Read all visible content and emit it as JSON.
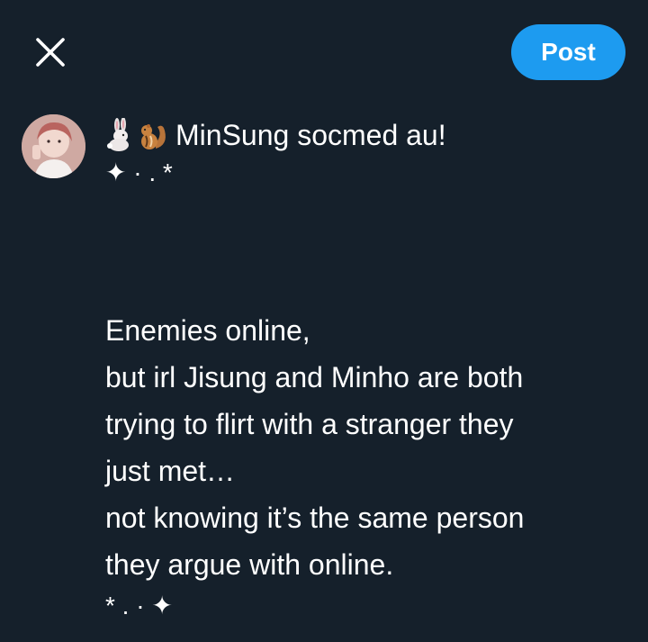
{
  "toolbar": {
    "close_icon": "close-icon",
    "post_label": "Post",
    "accent_color": "#1d9bf0"
  },
  "composer": {
    "avatar_icon": "user-avatar",
    "title_emojis": [
      "rabbit-emoji",
      "chipmunk-emoji"
    ],
    "title": "MinSung socmed au!",
    "sparkle_open": "✦ · . *",
    "body_lines": [
      "Enemies online,",
      "but irl Jisung and Minho are both",
      "trying to flirt with a stranger they",
      "just met…",
      "not knowing it’s the same person",
      "they argue with online."
    ],
    "sparkle_close": "* . · ✦"
  },
  "colors": {
    "background": "#15202b",
    "text": "#ffffff"
  }
}
